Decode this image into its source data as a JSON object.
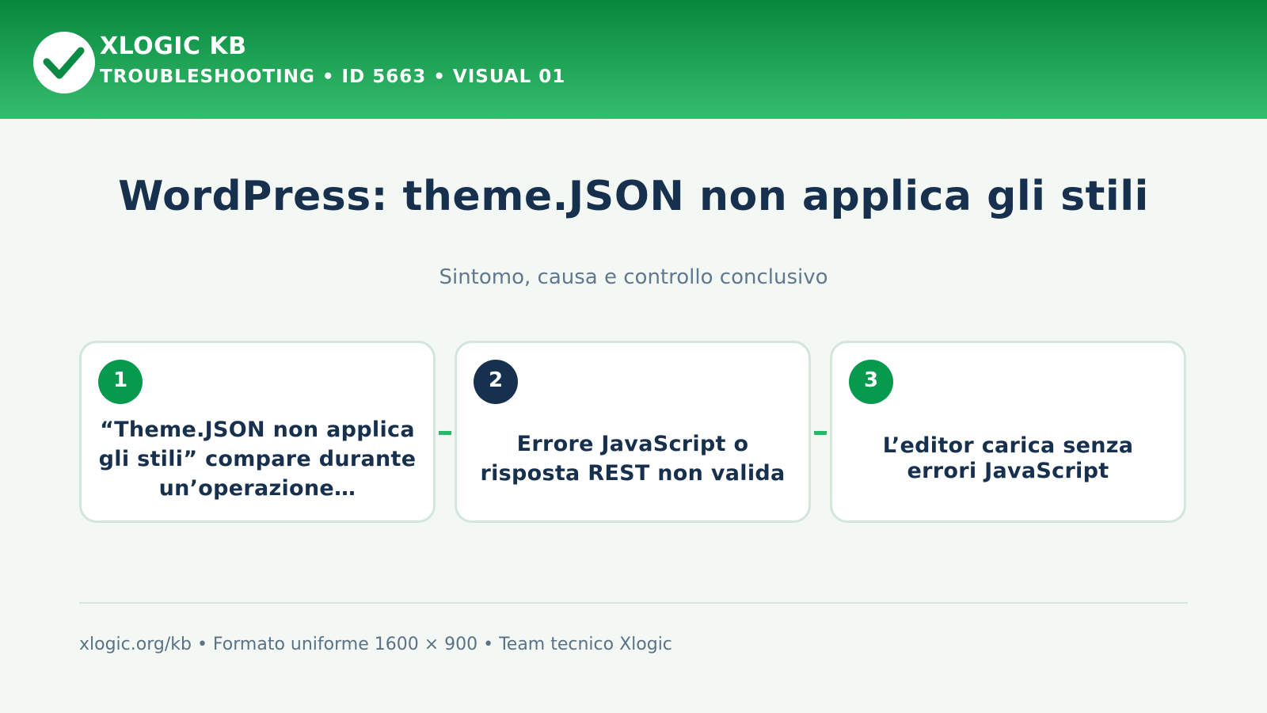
{
  "header": {
    "brand": "XLOGIC KB",
    "meta": "TROUBLESHOOTING • ID 5663 • VISUAL 01",
    "logo_icon": "check-icon",
    "gradient_top": "#06873c",
    "gradient_bottom": "#36bd6d"
  },
  "main": {
    "title": "WordPress: theme.JSON non applica gli stili",
    "subtitle": "Sintomo, causa e controllo conclusivo"
  },
  "steps": [
    {
      "number": "1",
      "text": "“Theme.JSON non applica gli stili” compare durante un’operazione…",
      "badge_color": "#079a4f"
    },
    {
      "number": "2",
      "text": "Errore JavaScript o risposta REST non valida",
      "badge_color": "#17304d"
    },
    {
      "number": "3",
      "text": "L’editor carica senza errori JavaScript",
      "badge_color": "#079a4f"
    }
  ],
  "footer": {
    "text": "xlogic.org/kb • Formato uniforme 1600 × 900 • Team tecnico Xlogic"
  },
  "colors": {
    "background": "#f3f8f5",
    "title": "#17304d",
    "accent": "#2fb56a"
  }
}
